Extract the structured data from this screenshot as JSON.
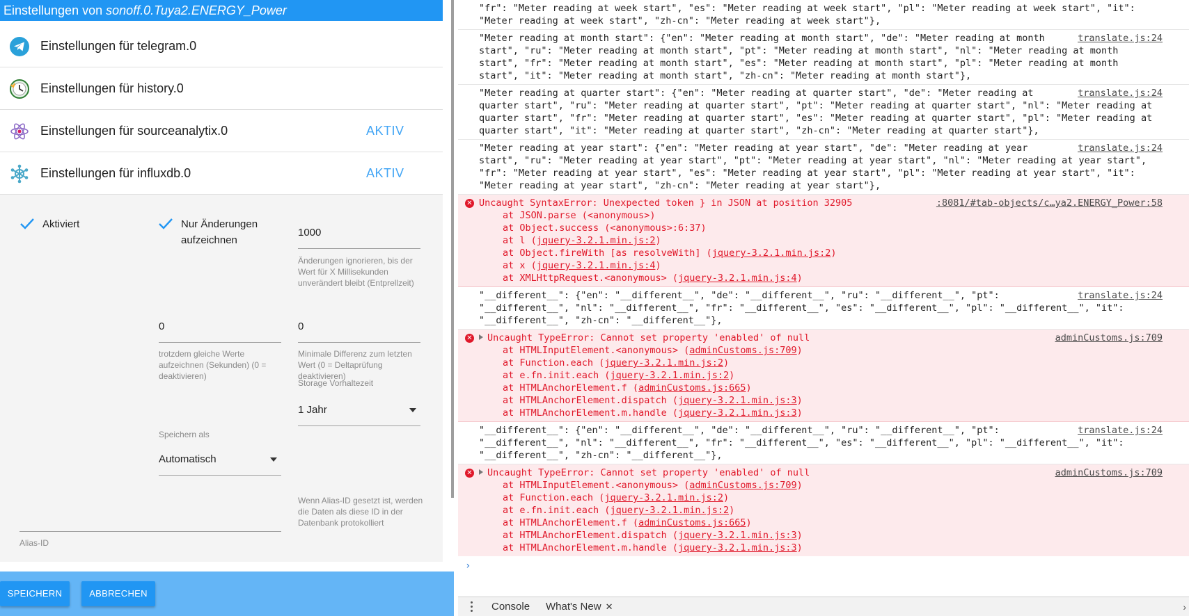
{
  "dialog": {
    "title_prefix": "Einstellungen von ",
    "title_object": "sonoff.0.Tuya2.ENERGY_Power",
    "adapters": [
      {
        "icon": "telegram-icon",
        "label": "Einstellungen für telegram.0",
        "status": ""
      },
      {
        "icon": "history-clock-icon",
        "label": "Einstellungen für history.0",
        "status": ""
      },
      {
        "icon": "sourceanalytix-atom-icon",
        "label": "Einstellungen für sourceanalytix.0",
        "status": "AKTIV"
      },
      {
        "icon": "influxdb-icon",
        "label": "Einstellungen für influxdb.0",
        "status": "AKTIV"
      }
    ],
    "settings": {
      "activated_label": "Aktiviert",
      "only_changes_label": "Nur Änderungen aufzeichnen",
      "debounce_value": "1000",
      "debounce_help": "Änderungen ignorieren, bis der Wert für X Millisekunden unverändert bleibt (Entprellzeit)",
      "same_values_value": "0",
      "same_values_help": "trotzdem gleiche Werte aufzeichnen (Sekunden) (0 = deaktivieren)",
      "min_diff_value": "0",
      "min_diff_help": "Minimale Differenz zum letzten Wert (0 = Deltaprüfung deaktivieren)",
      "storage_label": "Storage Vorhaltezeit",
      "storage_value": "1 Jahr",
      "save_as_label": "Speichern als",
      "save_as_value": "Automatisch",
      "alias_help": "Wenn Alias-ID gesetzt ist, werden die Daten als diese ID in der Datenbank protokolliert",
      "alias_label": "Alias-ID",
      "alias_value": ""
    },
    "buttons": {
      "save": "SPEICHERN",
      "cancel": "ABBRECHEN"
    }
  },
  "console": {
    "messages": [
      {
        "type": "info",
        "source": "",
        "lines": [
          "\"fr\": \"Meter reading at week start\", \"es\": \"Meter reading at week start\", \"pl\": \"Meter reading at week start\", \"it\":",
          "\"Meter reading at week start\", \"zh-cn\": \"Meter reading at week start\"},"
        ]
      },
      {
        "type": "info",
        "source": "translate.js:24",
        "lines": [
          "\"Meter reading at month start\": {\"en\": \"Meter reading at month start\", \"de\": \"Meter reading at month",
          "start\", \"ru\": \"Meter reading at month start\", \"pt\": \"Meter reading at month start\", \"nl\": \"Meter reading at month",
          "start\", \"fr\": \"Meter reading at month start\", \"es\": \"Meter reading at month start\", \"pl\": \"Meter reading at month",
          "start\", \"it\": \"Meter reading at month start\", \"zh-cn\": \"Meter reading at month start\"},"
        ]
      },
      {
        "type": "info",
        "source": "translate.js:24",
        "lines": [
          "\"Meter reading at quarter start\": {\"en\": \"Meter reading at quarter start\", \"de\": \"Meter reading at",
          "quarter start\", \"ru\": \"Meter reading at quarter start\", \"pt\": \"Meter reading at quarter start\", \"nl\": \"Meter reading at",
          "quarter start\", \"fr\": \"Meter reading at quarter start\", \"es\": \"Meter reading at quarter start\", \"pl\": \"Meter reading at",
          "quarter start\", \"it\": \"Meter reading at quarter start\", \"zh-cn\": \"Meter reading at quarter start\"},"
        ]
      },
      {
        "type": "info",
        "source": "translate.js:24",
        "lines": [
          "\"Meter reading at year start\": {\"en\": \"Meter reading at year start\", \"de\": \"Meter reading at year",
          "start\", \"ru\": \"Meter reading at year start\", \"pt\": \"Meter reading at year start\", \"nl\": \"Meter reading at year start\",",
          "\"fr\": \"Meter reading at year start\", \"es\": \"Meter reading at year start\", \"pl\": \"Meter reading at year start\", \"it\":",
          "\"Meter reading at year start\", \"zh-cn\": \"Meter reading at year start\"},"
        ]
      },
      {
        "type": "err",
        "expandable": false,
        "source": ":8081/#tab-objects/c…ya2.ENERGY_Power:58",
        "lines": [
          "Uncaught SyntaxError: Unexpected token } in JSON at position 32905"
        ],
        "stack": [
          [
            "at JSON.parse (<anonymous>)",
            ""
          ],
          [
            "at Object.success (<anonymous>:6:37)",
            ""
          ],
          [
            "at l (",
            "jquery-3.2.1.min.js:2",
            ")"
          ],
          [
            "at Object.fireWith [as resolveWith] (",
            "jquery-3.2.1.min.js:2",
            ")"
          ],
          [
            "at x (",
            "jquery-3.2.1.min.js:4",
            ")"
          ],
          [
            "at XMLHttpRequest.<anonymous> (",
            "jquery-3.2.1.min.js:4",
            ")"
          ]
        ]
      },
      {
        "type": "info",
        "source": "translate.js:24",
        "lines": [
          "\"__different__\": {\"en\": \"__different__\", \"de\": \"__different__\", \"ru\": \"__different__\", \"pt\":",
          "\"__different__\", \"nl\": \"__different__\", \"fr\": \"__different__\", \"es\": \"__different__\", \"pl\": \"__different__\", \"it\":",
          "\"__different__\", \"zh-cn\": \"__different__\"},"
        ]
      },
      {
        "type": "err",
        "expandable": true,
        "source": "adminCustoms.js:709",
        "lines": [
          "Uncaught TypeError: Cannot set property 'enabled' of null"
        ],
        "stack": [
          [
            "at HTMLInputElement.<anonymous> (",
            "adminCustoms.js:709",
            ")"
          ],
          [
            "at Function.each (",
            "jquery-3.2.1.min.js:2",
            ")"
          ],
          [
            "at e.fn.init.each (",
            "jquery-3.2.1.min.js:2",
            ")"
          ],
          [
            "at HTMLAnchorElement.f (",
            "adminCustoms.js:665",
            ")"
          ],
          [
            "at HTMLAnchorElement.dispatch (",
            "jquery-3.2.1.min.js:3",
            ")"
          ],
          [
            "at HTMLAnchorElement.m.handle (",
            "jquery-3.2.1.min.js:3",
            ")"
          ]
        ]
      },
      {
        "type": "info",
        "source": "translate.js:24",
        "lines": [
          "\"__different__\": {\"en\": \"__different__\", \"de\": \"__different__\", \"ru\": \"__different__\", \"pt\":",
          "\"__different__\", \"nl\": \"__different__\", \"fr\": \"__different__\", \"es\": \"__different__\", \"pl\": \"__different__\", \"it\":",
          "\"__different__\", \"zh-cn\": \"__different__\"},"
        ]
      },
      {
        "type": "err",
        "expandable": true,
        "source": "adminCustoms.js:709",
        "lines": [
          "Uncaught TypeError: Cannot set property 'enabled' of null"
        ],
        "stack": [
          [
            "at HTMLInputElement.<anonymous> (",
            "adminCustoms.js:709",
            ")"
          ],
          [
            "at Function.each (",
            "jquery-3.2.1.min.js:2",
            ")"
          ],
          [
            "at e.fn.init.each (",
            "jquery-3.2.1.min.js:2",
            ")"
          ],
          [
            "at HTMLAnchorElement.f (",
            "adminCustoms.js:665",
            ")"
          ],
          [
            "at HTMLAnchorElement.dispatch (",
            "jquery-3.2.1.min.js:3",
            ")"
          ],
          [
            "at HTMLAnchorElement.m.handle (",
            "jquery-3.2.1.min.js:3",
            ")"
          ]
        ]
      }
    ],
    "prompt_symbol": "›",
    "drawer_tabs": [
      {
        "label": "Console",
        "closable": false
      },
      {
        "label": "What's New",
        "closable": true
      }
    ],
    "close_glyph": "✕"
  },
  "colors": {
    "accent": "#2196f3",
    "footer": "#64b5f6",
    "status": "#42a5f5",
    "error": "#e0182a",
    "error_bg": "#fdeaec"
  }
}
